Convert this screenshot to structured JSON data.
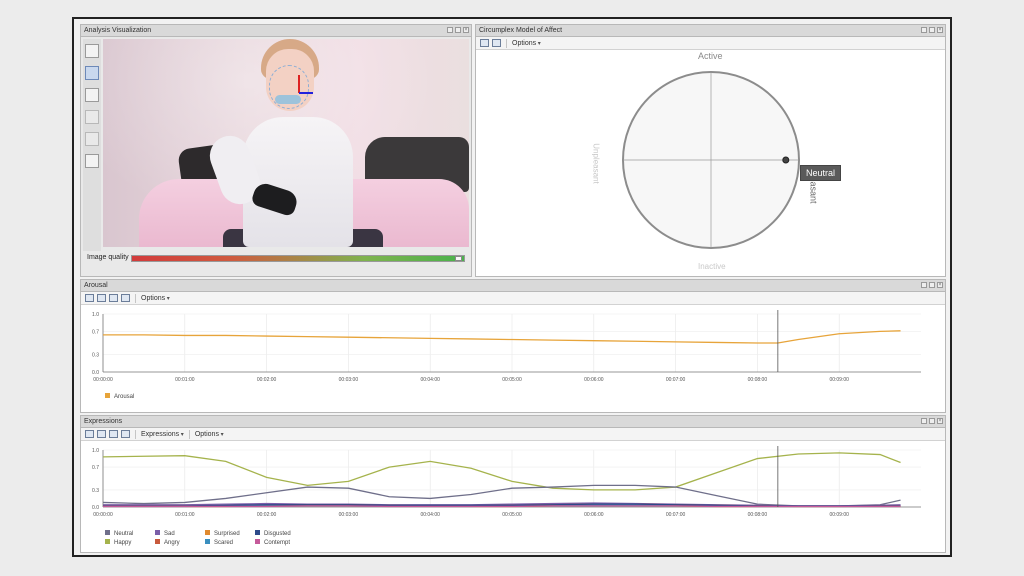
{
  "panels": {
    "analysis": {
      "title": "Analysis Visualization",
      "quality_label": "Image quality"
    },
    "circumplex": {
      "title": "Circumplex Model of Affect",
      "toolbar": {
        "options_label": "Options"
      },
      "axis_top": "Active",
      "axis_right": "Pleasant",
      "axis_left": "Unpleasant",
      "axis_bottom": "Inactive",
      "badge": "Neutral"
    },
    "arousal": {
      "title": "Arousal",
      "toolbar": {
        "options_label": "Options"
      }
    },
    "expressions": {
      "title": "Expressions",
      "toolbar": {
        "expressions_label": "Expressions",
        "options_label": "Options"
      }
    }
  },
  "chart_data": [
    {
      "type": "line",
      "name": "arousal",
      "x": [
        "00:00:00",
        "00:00:30",
        "00:01:00",
        "00:01:30",
        "00:02:00",
        "00:02:30",
        "00:03:00",
        "00:03:30",
        "00:04:00",
        "00:04:30",
        "00:05:00",
        "00:05:30",
        "00:06:00",
        "00:06:30",
        "00:07:00",
        "00:07:30",
        "00:08:00",
        "00:08:15",
        "00:08:30",
        "00:09:00",
        "00:09:30",
        "00:09:45"
      ],
      "ytick_labels": [
        "0.0",
        "0.3",
        "0.7",
        "1.0"
      ],
      "ylim": [
        0,
        1
      ],
      "xtick_labels": [
        "00:00:00",
        "00:01:00",
        "00:02:00",
        "00:03:00",
        "00:04:00",
        "00:05:00",
        "00:06:00",
        "00:07:00",
        "00:08:00",
        "00:09:00"
      ],
      "series": [
        {
          "name": "Arousal",
          "color": "#e7a43a",
          "values": [
            0.64,
            0.64,
            0.63,
            0.63,
            0.62,
            0.61,
            0.6,
            0.59,
            0.58,
            0.57,
            0.56,
            0.55,
            0.54,
            0.53,
            0.52,
            0.51,
            0.5,
            0.5,
            0.56,
            0.66,
            0.7,
            0.71
          ]
        }
      ],
      "cursor_x": "00:08:15",
      "legend": "bottom-left"
    },
    {
      "type": "line",
      "name": "expressions",
      "x": [
        "00:00:00",
        "00:00:30",
        "00:01:00",
        "00:01:30",
        "00:02:00",
        "00:02:30",
        "00:03:00",
        "00:03:30",
        "00:04:00",
        "00:04:30",
        "00:05:00",
        "00:05:30",
        "00:06:00",
        "00:06:30",
        "00:07:00",
        "00:07:30",
        "00:08:00",
        "00:08:30",
        "00:09:00",
        "00:09:30",
        "00:09:45"
      ],
      "ytick_labels": [
        "0.0",
        "0.3",
        "0.7",
        "1.0"
      ],
      "ylim": [
        0,
        1
      ],
      "xtick_labels": [
        "00:00:00",
        "00:01:00",
        "00:02:00",
        "00:03:00",
        "00:04:00",
        "00:05:00",
        "00:06:00",
        "00:07:00",
        "00:08:00",
        "00:09:00"
      ],
      "series": [
        {
          "name": "Happy",
          "color": "#a5b34c",
          "values": [
            0.88,
            0.89,
            0.9,
            0.8,
            0.52,
            0.38,
            0.45,
            0.7,
            0.8,
            0.68,
            0.45,
            0.33,
            0.3,
            0.3,
            0.35,
            0.6,
            0.85,
            0.93,
            0.95,
            0.92,
            0.78
          ]
        },
        {
          "name": "Neutral",
          "color": "#6f6f8a",
          "values": [
            0.08,
            0.06,
            0.08,
            0.15,
            0.25,
            0.35,
            0.33,
            0.18,
            0.15,
            0.22,
            0.33,
            0.35,
            0.38,
            0.38,
            0.35,
            0.2,
            0.05,
            0.02,
            0.02,
            0.04,
            0.12
          ]
        },
        {
          "name": "Sad",
          "color": "#7a5ea8",
          "values": [
            0.04,
            0.04,
            0.04,
            0.05,
            0.06,
            0.05,
            0.05,
            0.04,
            0.04,
            0.04,
            0.05,
            0.06,
            0.07,
            0.06,
            0.05,
            0.04,
            0.03,
            0.02,
            0.02,
            0.03,
            0.04
          ]
        },
        {
          "name": "Angry",
          "color": "#c85a3c",
          "values": [
            0.02,
            0.02,
            0.02,
            0.02,
            0.03,
            0.04,
            0.04,
            0.03,
            0.02,
            0.02,
            0.03,
            0.04,
            0.05,
            0.05,
            0.04,
            0.03,
            0.02,
            0.01,
            0.01,
            0.02,
            0.02
          ]
        },
        {
          "name": "Surprised",
          "color": "#e08a2e",
          "values": [
            0.01,
            0.01,
            0.01,
            0.01,
            0.02,
            0.02,
            0.02,
            0.01,
            0.01,
            0.01,
            0.01,
            0.02,
            0.02,
            0.02,
            0.02,
            0.01,
            0.01,
            0.01,
            0.01,
            0.01,
            0.01
          ]
        },
        {
          "name": "Scared",
          "color": "#3a8fbf",
          "values": [
            0.01,
            0.01,
            0.01,
            0.02,
            0.02,
            0.02,
            0.02,
            0.01,
            0.01,
            0.01,
            0.02,
            0.02,
            0.03,
            0.03,
            0.02,
            0.02,
            0.01,
            0.01,
            0.01,
            0.01,
            0.01
          ]
        },
        {
          "name": "Disgusted",
          "color": "#2d4a8a",
          "values": [
            0.02,
            0.02,
            0.02,
            0.03,
            0.04,
            0.04,
            0.04,
            0.03,
            0.03,
            0.03,
            0.03,
            0.04,
            0.05,
            0.05,
            0.04,
            0.03,
            0.02,
            0.02,
            0.02,
            0.02,
            0.02
          ]
        },
        {
          "name": "Contempt",
          "color": "#c55a9a",
          "values": [
            0.01,
            0.01,
            0.01,
            0.01,
            0.01,
            0.02,
            0.02,
            0.01,
            0.01,
            0.01,
            0.01,
            0.02,
            0.02,
            0.02,
            0.02,
            0.01,
            0.01,
            0.01,
            0.01,
            0.01,
            0.01
          ]
        }
      ],
      "cursor_x": "00:08:15",
      "legend": "bottom-left"
    }
  ],
  "circumplex_point": {
    "valence": 0.85,
    "arousal": 0.0
  },
  "colors": {
    "title_bar": "#d9d9d9",
    "quality_low": "#d23b3b",
    "quality_high": "#49b24b",
    "circle": "#8c8c8c"
  },
  "quality_value": 0.99
}
